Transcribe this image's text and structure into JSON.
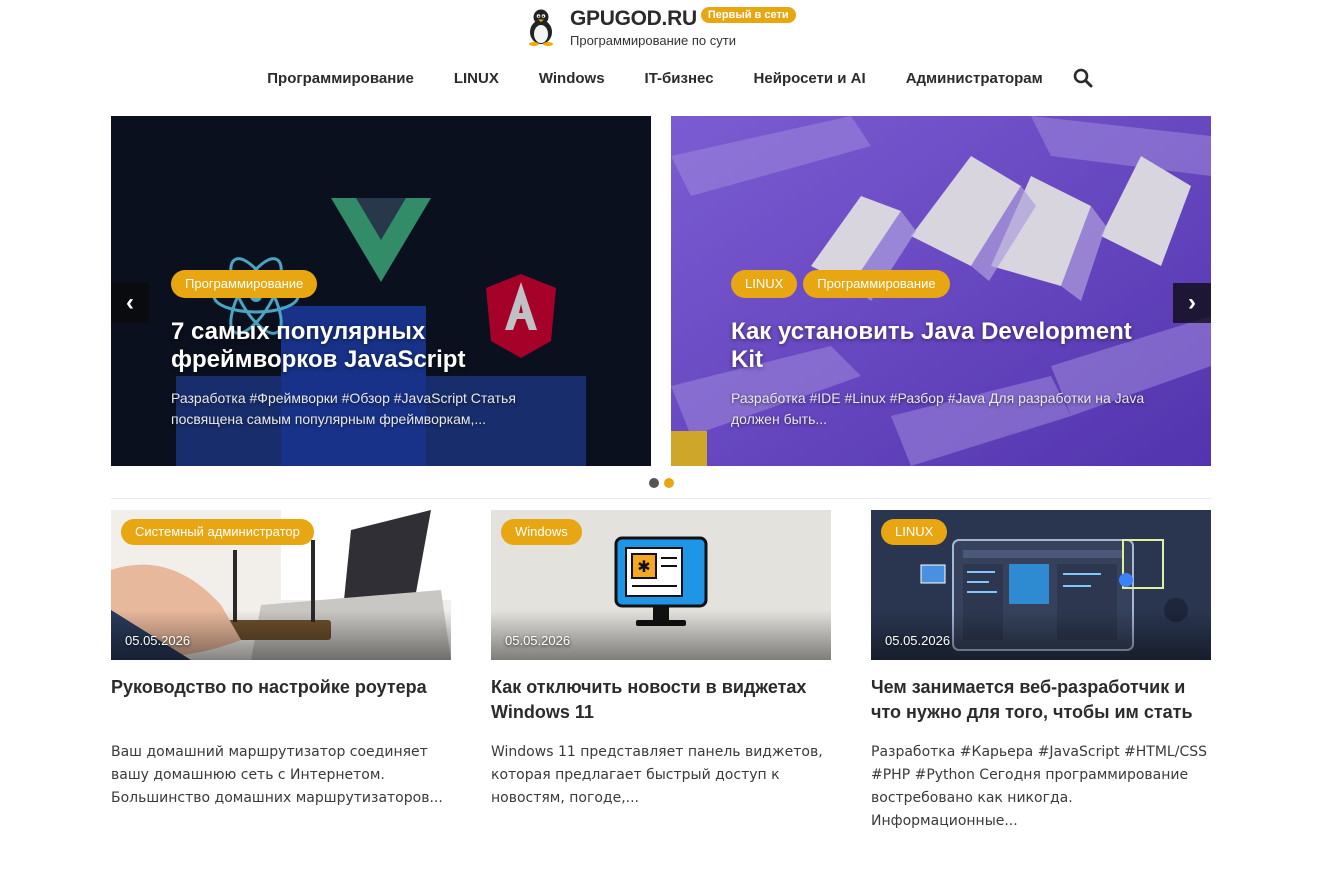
{
  "header": {
    "site_name": "GPUGOD.RU",
    "badge": "Первый в сети",
    "tagline": "Программирование по сути",
    "logo_icon": "penguin-icon"
  },
  "nav": {
    "items": [
      {
        "label": "Программирование"
      },
      {
        "label": "LINUX"
      },
      {
        "label": "Windows"
      },
      {
        "label": "IT-бизнес"
      },
      {
        "label": "Нейросети и AI"
      },
      {
        "label": "Администраторам"
      }
    ],
    "search_icon": "search-icon"
  },
  "slider": {
    "prev_symbol": "‹",
    "next_symbol": "›",
    "slides": [
      {
        "tags": [
          "Программирование"
        ],
        "title": "7 самых популярных фреймворков JavaScript",
        "excerpt": "Разработка #Фреймворки #Обзор #JavaScript Статья посвящена самым популярным фреймворкам,..."
      },
      {
        "tags": [
          "LINUX",
          "Программирование"
        ],
        "title": "Как установить Java Development Kit",
        "excerpt": "Разработка #IDE #Linux #Разбор #Java Для разработки на Java должен быть..."
      }
    ],
    "dots_count": 2,
    "active_dot": 2
  },
  "cards": [
    {
      "tag": "Системный администратор",
      "date": "05.05.2026",
      "title": "Руководство по настройке роутера",
      "excerpt": "Ваш домашний маршрутизатор соединяет вашу домашнюю сеть с Интернетом. Большинство домашних маршрутизаторов..."
    },
    {
      "tag": "Windows",
      "date": "05.05.2026",
      "title": "Как отключить новости в виджетах Windows 11",
      "excerpt": "Windows 11 представляет панель виджетов, которая предлагает быстрый доступ к новостям, погоде,..."
    },
    {
      "tag": "LINUX",
      "date": "05.05.2026",
      "title": "Чем занимается веб-разработчик и что нужно для того, чтобы им стать",
      "excerpt": "Разработка #Карьера #JavaScript #HTML/CSS #PHP #Python Сегодня программирование востребовано как никогда. Информационные..."
    }
  ],
  "colors": {
    "accent": "#e8a712",
    "text_dark": "#2b2b2b"
  }
}
